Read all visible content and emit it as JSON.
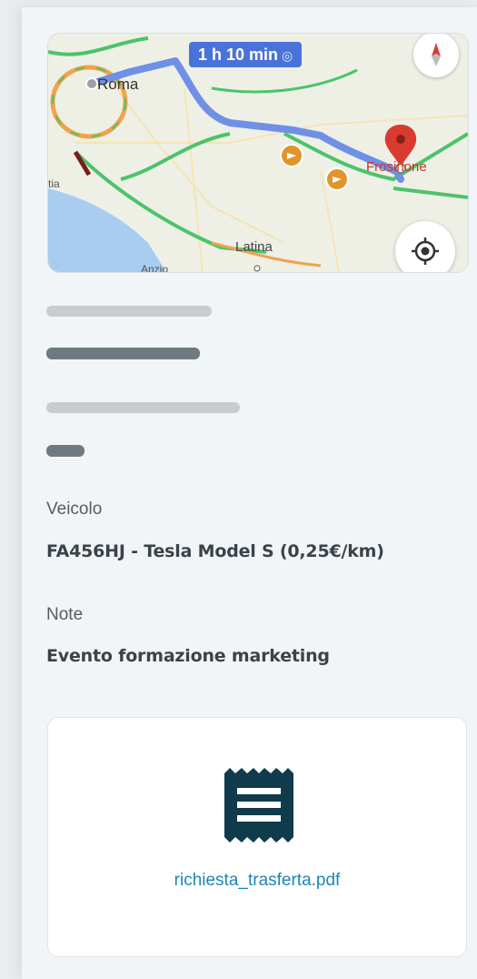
{
  "map": {
    "eta": "1 h 10 min",
    "labels": {
      "roma": "Roma",
      "frosinone": "Frosinone",
      "latina": "Latina",
      "tia": "tia",
      "anzio": "Anzio"
    },
    "colors": {
      "route": "#6f90e6",
      "traffic_green": "#4cc36a",
      "traffic_orange": "#f0a34a",
      "destination_pin": "#d93b30",
      "sea": "#a9cdf0"
    }
  },
  "details": {
    "vehicle_label": "Veicolo",
    "vehicle_value": "FA456HJ - Tesla Model S (0,25€/km)",
    "notes_label": "Note",
    "notes_value": "Evento formazione marketing"
  },
  "attachment": {
    "icon": "receipt-icon",
    "filename": "richiesta_trasferta.pdf",
    "icon_color": "#0f3b4d",
    "link_color": "#1d86b8"
  }
}
